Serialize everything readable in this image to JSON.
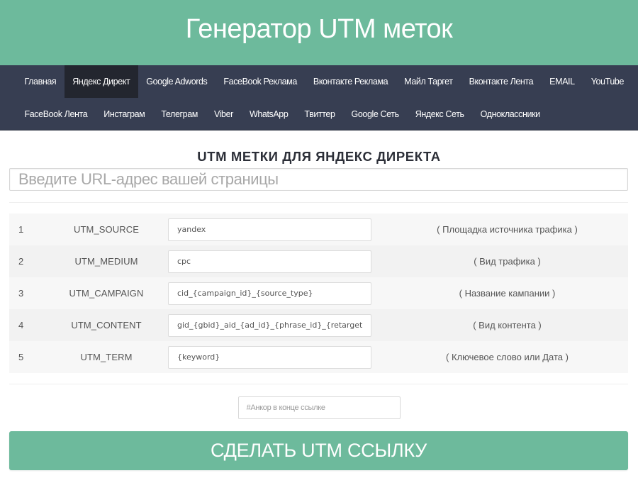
{
  "header": {
    "title": "Генератор UTM меток"
  },
  "nav": {
    "active_index": 1,
    "rows": [
      [
        {
          "label": "Главная"
        },
        {
          "label": "Яндекс Директ"
        },
        {
          "label": "Google Adwords"
        },
        {
          "label": "FaceBook Реклама"
        },
        {
          "label": "Вконтакте Реклама"
        },
        {
          "label": "Майл Таргет"
        },
        {
          "label": "Вконтакте Лента"
        },
        {
          "label": "EMAIL"
        },
        {
          "label": "YouTube"
        }
      ],
      [
        {
          "label": "FaceBook Лента"
        },
        {
          "label": "Инстаграм"
        },
        {
          "label": "Телеграм"
        },
        {
          "label": "Viber"
        },
        {
          "label": "WhatsApp"
        },
        {
          "label": "Твиттер"
        },
        {
          "label": "Google Сеть"
        },
        {
          "label": "Яндекс Сеть"
        },
        {
          "label": "Одноклассники"
        }
      ]
    ]
  },
  "main": {
    "section_title": "UTM МЕТКИ ДЛЯ ЯНДЕКС ДИРЕКТА",
    "url_input": {
      "placeholder": "Введите URL-адрес вашей страницы",
      "value": ""
    },
    "params": [
      {
        "num": "1",
        "name": "UTM_SOURCE",
        "value": "yandex",
        "desc": "( Площадка источника трафика )"
      },
      {
        "num": "2",
        "name": "UTM_MEDIUM",
        "value": "cpc",
        "desc": "( Вид трафика )"
      },
      {
        "num": "3",
        "name": "UTM_CAMPAIGN",
        "value": "cid_{campaign_id}_{source_type}",
        "desc": "( Название кампании )"
      },
      {
        "num": "4",
        "name": "UTM_CONTENT",
        "value": "gid_{gbid}_aid_{ad_id}_{phrase_id}_{retargeting_id}",
        "desc": "( Вид контента )"
      },
      {
        "num": "5",
        "name": "UTM_TERM",
        "value": "{keyword}",
        "desc": "( Ключевое слово или Дата )"
      }
    ],
    "anchor_input": {
      "placeholder": "#Анкор в конце ссылке",
      "value": ""
    },
    "submit_label": "СДЕЛАТЬ UTM ССЫЛКУ"
  },
  "colors": {
    "accent": "#6dba9c",
    "nav_bg": "#373e52",
    "nav_active_bg": "#23262f"
  }
}
